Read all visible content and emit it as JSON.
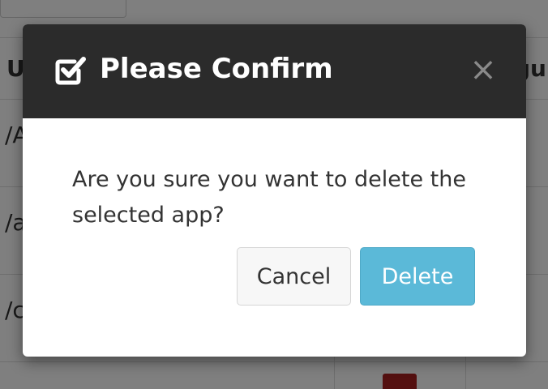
{
  "background": {
    "partial_texts": [
      "U",
      "/A",
      "/a",
      "/c",
      "gu"
    ]
  },
  "modal": {
    "title": "Please Confirm",
    "title_icon": "checkbox-checked-icon",
    "close_glyph": "×",
    "message": "Are you sure you want to delete the selected app?",
    "buttons": {
      "cancel_label": "Cancel",
      "delete_label": "Delete"
    }
  },
  "colors": {
    "header_bg": "#2b2b2b",
    "delete_button": "#5bb9d8",
    "cancel_button": "#f7f7f7",
    "overlay": "rgba(0,0,0,0.5)",
    "badge_red": "#a92020"
  }
}
